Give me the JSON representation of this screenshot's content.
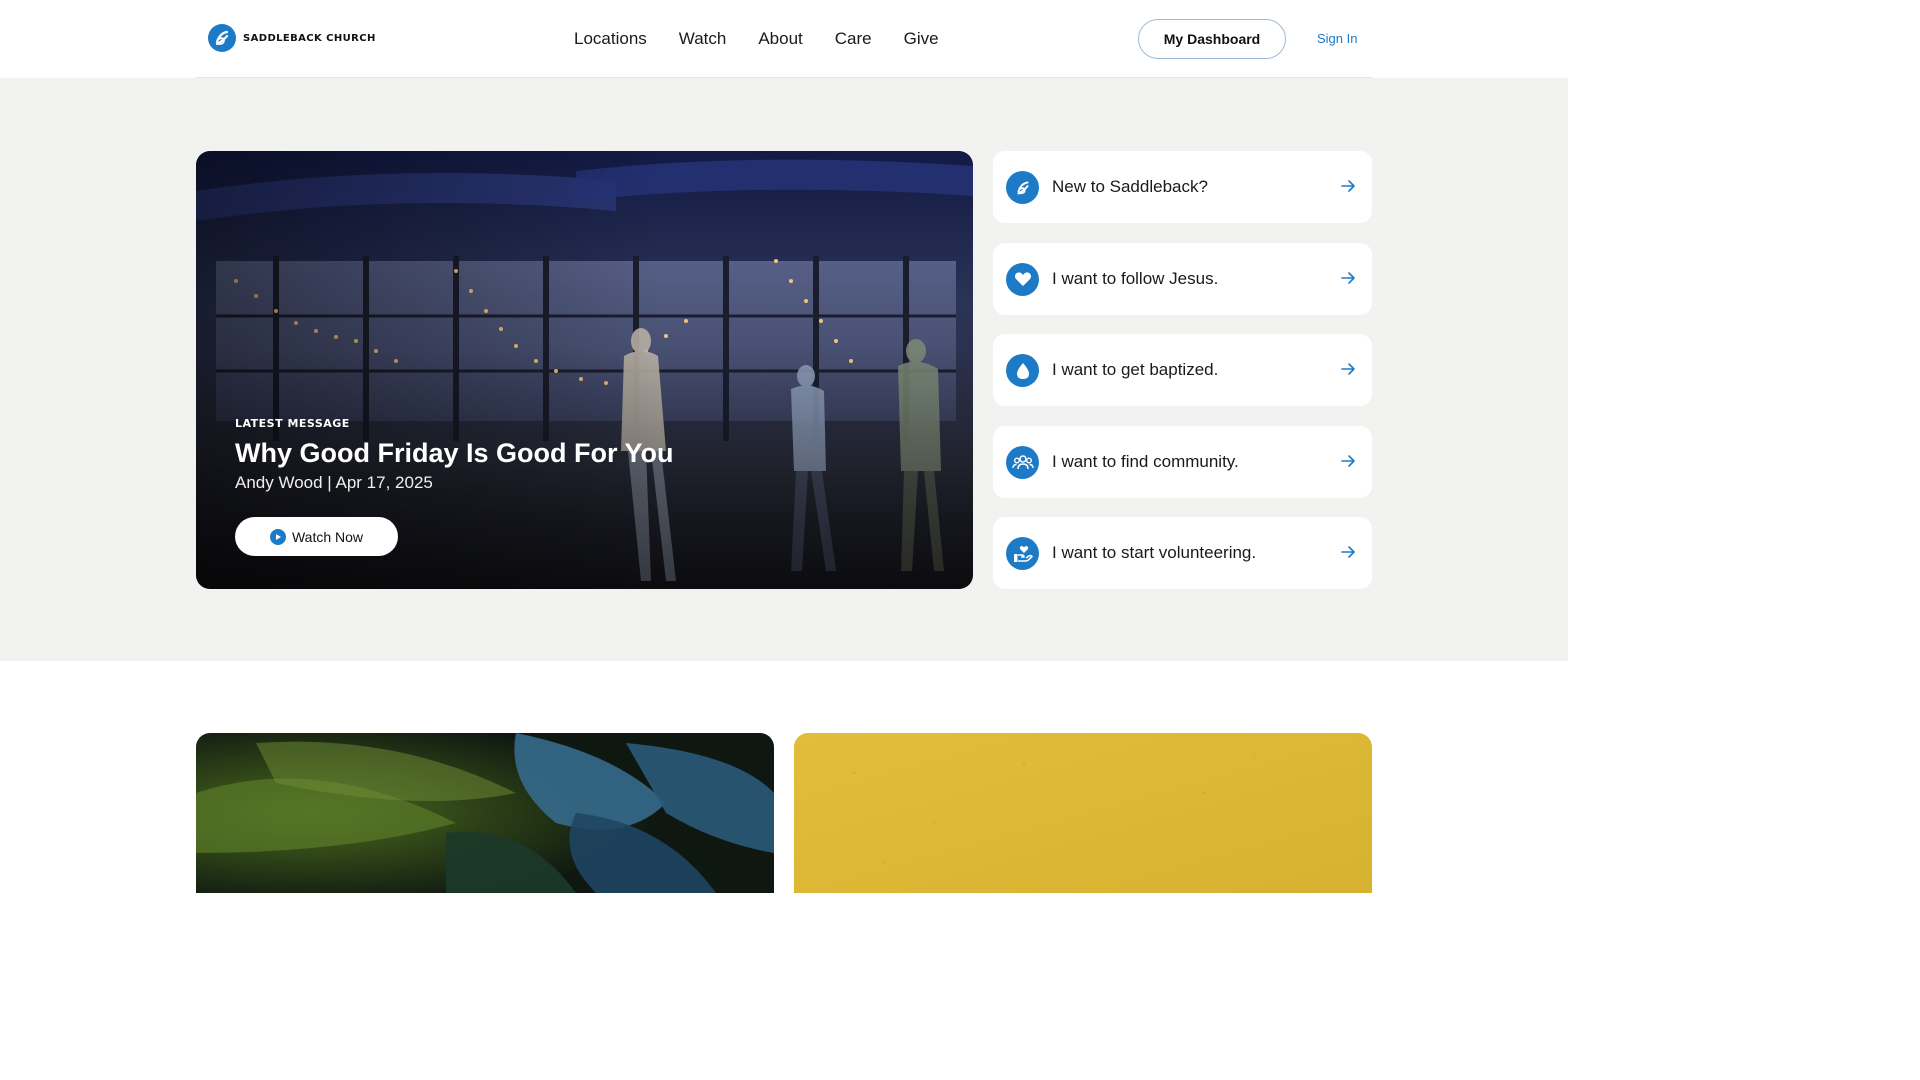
{
  "header": {
    "logo_text": "SADDLEBACK CHURCH",
    "nav": [
      "Locations",
      "Watch",
      "About",
      "Care",
      "Give"
    ],
    "dashboard_label": "My Dashboard",
    "sign_in_label": "Sign In"
  },
  "feature": {
    "eyebrow": "LATEST MESSAGE",
    "title": "Why Good Friday Is Good For You",
    "meta": "Andy Wood | Apr 17, 2025",
    "watch_label": "Watch Now"
  },
  "steps": [
    {
      "label": "New to Saddleback?",
      "icon": "saddleback-logo-icon"
    },
    {
      "label": "I want to follow Jesus.",
      "icon": "heart-icon"
    },
    {
      "label": "I want to get baptized.",
      "icon": "water-drop-icon"
    },
    {
      "label": "I want to find community.",
      "icon": "people-group-icon"
    },
    {
      "label": "I want to start volunteering.",
      "icon": "hand-heart-icon"
    }
  ],
  "colors": {
    "brand_blue": "#1d7ac7",
    "band_background": "#f2f2f0",
    "card_yellow": "#dcb833"
  }
}
